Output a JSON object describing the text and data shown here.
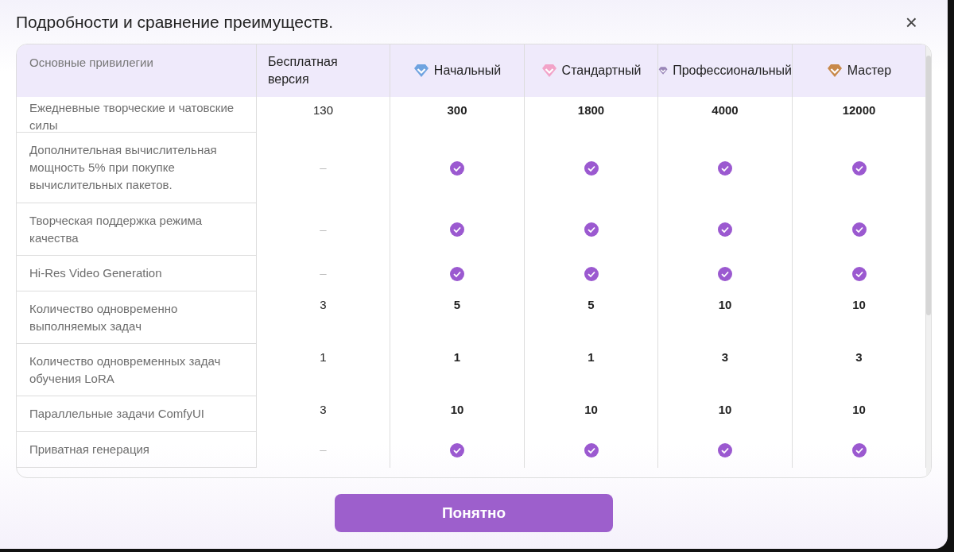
{
  "dialog": {
    "title": "Подробности и сравнение преимуществ.",
    "close": "×"
  },
  "table": {
    "header": "Основные привилегии",
    "plans": [
      {
        "name": "Бесплатная версия"
      },
      {
        "name": "Начальный",
        "color": "#6fa3e0"
      },
      {
        "name": "Стандартный",
        "color": "#f2a3c8"
      },
      {
        "name": "Профессиональный",
        "color": "#9a86b8"
      },
      {
        "name": "Мастер",
        "color": "#c8894a"
      }
    ],
    "rows": [
      {
        "label": "Ежедневные творческие и чатовские силы",
        "cells": [
          {
            "kind": "value",
            "text": "130"
          },
          {
            "kind": "value",
            "text": "300"
          },
          {
            "kind": "value",
            "text": "1800"
          },
          {
            "kind": "value",
            "text": "4000"
          },
          {
            "kind": "value",
            "text": "12000"
          }
        ]
      },
      {
        "label": "Дополнительная вычислительная мощность 5% при покупке вычислительных пакетов.",
        "cells": [
          {
            "kind": "dash",
            "text": "–"
          },
          {
            "kind": "check"
          },
          {
            "kind": "check"
          },
          {
            "kind": "check"
          },
          {
            "kind": "check"
          }
        ]
      },
      {
        "label": "Творческая поддержка режима качества",
        "cells": [
          {
            "kind": "dash",
            "text": "–"
          },
          {
            "kind": "check"
          },
          {
            "kind": "check"
          },
          {
            "kind": "check"
          },
          {
            "kind": "check"
          }
        ]
      },
      {
        "label": "Hi-Res Video Generation",
        "cells": [
          {
            "kind": "dash",
            "text": "–"
          },
          {
            "kind": "check"
          },
          {
            "kind": "check"
          },
          {
            "kind": "check"
          },
          {
            "kind": "check"
          }
        ]
      },
      {
        "label": "Количество одновременно выполняемых задач",
        "cells": [
          {
            "kind": "value",
            "text": "3"
          },
          {
            "kind": "value",
            "text": "5"
          },
          {
            "kind": "value",
            "text": "5"
          },
          {
            "kind": "value",
            "text": "10"
          },
          {
            "kind": "value",
            "text": "10"
          }
        ]
      },
      {
        "label": "Количество одновременных задач обучения LoRA",
        "cells": [
          {
            "kind": "value",
            "text": "1"
          },
          {
            "kind": "value",
            "text": "1"
          },
          {
            "kind": "value",
            "text": "1"
          },
          {
            "kind": "value",
            "text": "3"
          },
          {
            "kind": "value",
            "text": "3"
          }
        ]
      },
      {
        "label": "Параллельные задачи ComfyUI",
        "cells": [
          {
            "kind": "value",
            "text": "3"
          },
          {
            "kind": "value",
            "text": "10"
          },
          {
            "kind": "value",
            "text": "10"
          },
          {
            "kind": "value",
            "text": "10"
          },
          {
            "kind": "value",
            "text": "10"
          }
        ]
      },
      {
        "label": "Приватная генерация",
        "cells": [
          {
            "kind": "dash",
            "text": "–"
          },
          {
            "kind": "check"
          },
          {
            "kind": "check"
          },
          {
            "kind": "check"
          },
          {
            "kind": "check"
          }
        ]
      }
    ]
  },
  "button": "Понятно"
}
